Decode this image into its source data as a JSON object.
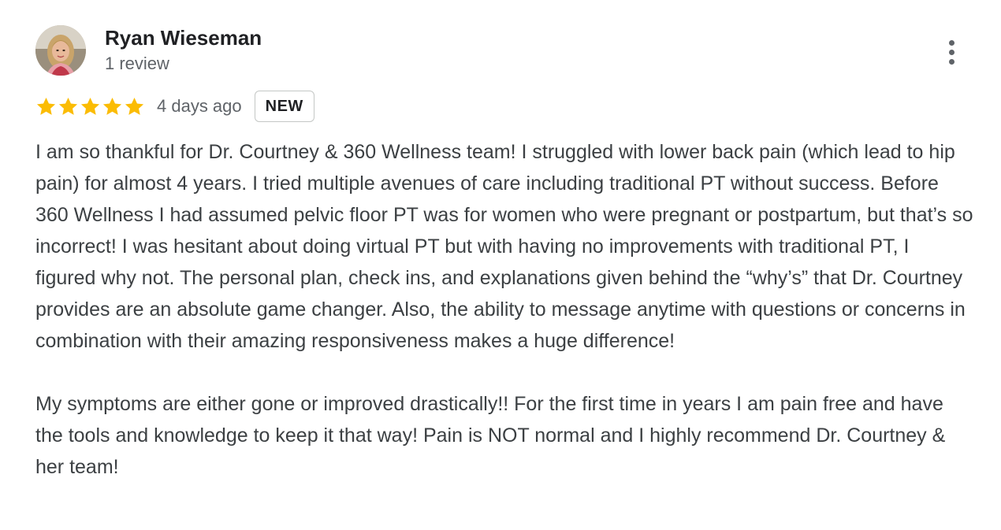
{
  "reviewer": {
    "name": "Ryan Wieseman",
    "review_count": "1 review",
    "avatar_icon": "user-photo-avatar"
  },
  "rating": {
    "stars": 5,
    "max_stars": 5,
    "star_color": "#fbbc04",
    "date": "4 days ago",
    "badge": "NEW"
  },
  "review": {
    "text": "I am so thankful for Dr. Courtney & 360 Wellness team! I struggled with lower back pain (which lead to hip pain) for almost 4 years. I tried multiple avenues of care including traditional PT without success. Before 360 Wellness I had assumed pelvic floor PT was for women who were pregnant or postpartum, but that’s so incorrect! I was hesitant about doing virtual PT but with having no improvements with traditional PT, I figured why not. The personal plan, check ins, and explanations given behind the “why’s” that Dr. Courtney provides are an absolute game changer. Also, the ability to message anytime with questions or concerns in combination with their amazing responsiveness makes a huge difference!\n\nMy symptoms are either gone or improved drastically!! For the first time in years I am pain free and have the tools and knowledge to keep it that way! Pain is NOT normal and I highly recommend Dr. Courtney & her team!"
  },
  "actions": {
    "more_icon": "more-vert-icon"
  }
}
